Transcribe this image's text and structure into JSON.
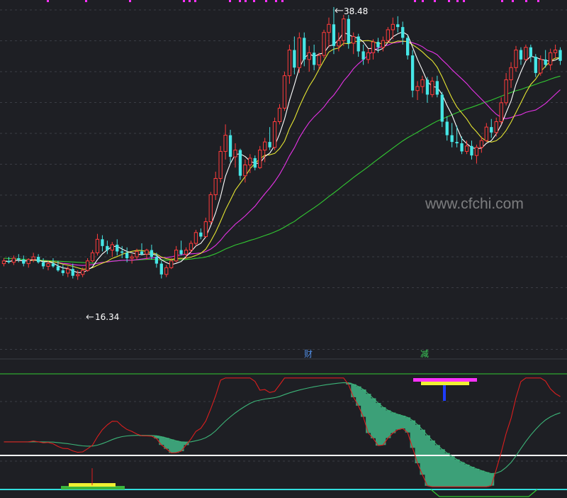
{
  "chart_data": {
    "type": "candlestick",
    "title": "",
    "annotations": {
      "high_label": "38.48",
      "low_label": "16.34",
      "marker_cai": "财",
      "marker_jian": "减",
      "watermark": "www.cfchi.com"
    },
    "price": {
      "ylim": [
        12.5,
        39.0
      ],
      "high": 38.48,
      "low": 16.34
    },
    "candles": [
      [
        19.5,
        19.9,
        19.3,
        19.7
      ],
      [
        19.7,
        20.0,
        19.5,
        19.6
      ],
      [
        19.6,
        20.1,
        19.4,
        19.9
      ],
      [
        19.9,
        20.2,
        19.6,
        19.8
      ],
      [
        19.8,
        20.1,
        19.3,
        19.5
      ],
      [
        19.5,
        19.9,
        19.2,
        19.8
      ],
      [
        19.8,
        20.3,
        19.6,
        20.0
      ],
      [
        20.0,
        20.2,
        19.5,
        19.6
      ],
      [
        19.6,
        19.9,
        19.1,
        19.3
      ],
      [
        19.3,
        19.7,
        19.0,
        19.5
      ],
      [
        19.5,
        19.9,
        19.2,
        19.3
      ],
      [
        19.3,
        19.7,
        18.9,
        19.0
      ],
      [
        19.0,
        19.4,
        18.6,
        18.8
      ],
      [
        18.8,
        19.3,
        18.5,
        19.1
      ],
      [
        19.1,
        19.5,
        18.4,
        18.6
      ],
      [
        18.6,
        19.0,
        18.3,
        18.7
      ],
      [
        18.7,
        19.2,
        18.5,
        19.0
      ],
      [
        19.0,
        19.9,
        18.9,
        19.7
      ],
      [
        19.7,
        20.5,
        19.6,
        20.3
      ],
      [
        20.3,
        21.7,
        20.1,
        21.3
      ],
      [
        21.3,
        21.6,
        20.4,
        20.8
      ],
      [
        20.8,
        21.2,
        20.2,
        20.5
      ],
      [
        20.5,
        21.1,
        20.0,
        20.9
      ],
      [
        20.9,
        21.3,
        20.1,
        20.4
      ],
      [
        20.4,
        20.8,
        19.9,
        20.3
      ],
      [
        20.3,
        20.7,
        19.6,
        19.9
      ],
      [
        19.9,
        20.2,
        19.5,
        20.0
      ],
      [
        20.0,
        20.6,
        19.8,
        20.4
      ],
      [
        20.4,
        21.0,
        20.1,
        20.2
      ],
      [
        20.2,
        20.6,
        19.8,
        20.5
      ],
      [
        20.5,
        20.9,
        19.8,
        20.0
      ],
      [
        20.0,
        20.3,
        19.2,
        19.5
      ],
      [
        19.5,
        19.7,
        18.4,
        18.7
      ],
      [
        18.7,
        19.4,
        18.5,
        19.2
      ],
      [
        19.2,
        19.9,
        19.1,
        19.7
      ],
      [
        19.7,
        20.8,
        19.6,
        20.5
      ],
      [
        20.5,
        21.2,
        20.1,
        20.2
      ],
      [
        20.2,
        20.7,
        19.9,
        20.5
      ],
      [
        20.5,
        21.2,
        20.3,
        21.0
      ],
      [
        21.0,
        22.0,
        20.8,
        21.8
      ],
      [
        21.8,
        22.1,
        21.3,
        21.5
      ],
      [
        21.5,
        22.9,
        21.4,
        22.6
      ],
      [
        22.6,
        24.8,
        22.4,
        24.6
      ],
      [
        24.6,
        26.3,
        24.2,
        25.8
      ],
      [
        25.8,
        28.2,
        25.5,
        27.8
      ],
      [
        27.8,
        29.8,
        27.2,
        29.0
      ],
      [
        29.0,
        29.4,
        27.0,
        27.4
      ],
      [
        27.4,
        28.4,
        26.6,
        27.9
      ],
      [
        27.9,
        28.0,
        25.7,
        26.0
      ],
      [
        26.0,
        27.2,
        25.5,
        26.8
      ],
      [
        26.8,
        27.6,
        26.2,
        27.3
      ],
      [
        27.3,
        27.5,
        26.4,
        26.6
      ],
      [
        26.6,
        28.2,
        26.5,
        27.9
      ],
      [
        27.9,
        28.8,
        27.0,
        28.5
      ],
      [
        28.5,
        29.6,
        27.9,
        28.1
      ],
      [
        28.1,
        30.3,
        27.9,
        30.0
      ],
      [
        30.0,
        31.3,
        29.8,
        31.0
      ],
      [
        31.0,
        33.7,
        30.8,
        33.4
      ],
      [
        33.4,
        35.7,
        32.8,
        35.3
      ],
      [
        35.3,
        36.3,
        33.5,
        34.0
      ],
      [
        34.0,
        36.6,
        33.6,
        36.2
      ],
      [
        36.2,
        36.6,
        34.1,
        34.6
      ],
      [
        34.6,
        35.6,
        33.7,
        35.1
      ],
      [
        35.1,
        35.7,
        33.8,
        34.2
      ],
      [
        34.2,
        35.1,
        33.9,
        34.9
      ],
      [
        34.9,
        36.8,
        34.7,
        36.6
      ],
      [
        36.6,
        37.7,
        35.5,
        37.2
      ],
      [
        37.2,
        38.48,
        35.0,
        35.6
      ],
      [
        35.6,
        36.6,
        35.2,
        36.0
      ],
      [
        36.0,
        37.9,
        35.6,
        37.6
      ],
      [
        37.6,
        37.9,
        35.4,
        35.8
      ],
      [
        35.8,
        36.6,
        35.0,
        36.3
      ],
      [
        36.3,
        36.5,
        34.8,
        35.2
      ],
      [
        35.2,
        35.7,
        34.2,
        34.6
      ],
      [
        34.6,
        35.4,
        34.3,
        35.1
      ],
      [
        35.1,
        36.1,
        34.6,
        35.9
      ],
      [
        35.9,
        36.2,
        35.1,
        35.5
      ],
      [
        35.5,
        36.3,
        35.2,
        36.0
      ],
      [
        36.0,
        37.0,
        35.8,
        36.8
      ],
      [
        36.8,
        37.7,
        36.1,
        37.2
      ],
      [
        37.2,
        37.8,
        36.6,
        37.0
      ],
      [
        37.0,
        37.4,
        35.7,
        36.2
      ],
      [
        36.2,
        36.4,
        34.6,
        34.9
      ],
      [
        34.9,
        35.3,
        31.8,
        32.3
      ],
      [
        32.3,
        33.0,
        31.6,
        32.6
      ],
      [
        32.6,
        33.4,
        32.1,
        33.1
      ],
      [
        33.1,
        33.3,
        31.4,
        32.0
      ],
      [
        32.0,
        33.3,
        31.8,
        33.0
      ],
      [
        33.0,
        33.4,
        31.8,
        32.0
      ],
      [
        32.0,
        32.2,
        29.6,
        30.0
      ],
      [
        30.0,
        30.4,
        28.6,
        29.0
      ],
      [
        29.0,
        29.9,
        28.1,
        28.5
      ],
      [
        28.5,
        29.7,
        28.1,
        28.4
      ],
      [
        28.4,
        28.9,
        27.6,
        27.8
      ],
      [
        27.8,
        28.6,
        27.6,
        28.2
      ],
      [
        28.2,
        28.6,
        27.2,
        27.5
      ],
      [
        27.5,
        28.3,
        26.9,
        28.1
      ],
      [
        28.1,
        28.9,
        27.7,
        28.6
      ],
      [
        28.6,
        29.9,
        28.5,
        29.6
      ],
      [
        29.6,
        30.2,
        28.8,
        29.2
      ],
      [
        29.2,
        30.3,
        28.9,
        30.0
      ],
      [
        30.0,
        31.8,
        29.8,
        31.4
      ],
      [
        31.4,
        33.6,
        31.2,
        33.1
      ],
      [
        33.1,
        34.4,
        32.5,
        34.0
      ],
      [
        34.0,
        35.6,
        33.7,
        35.3
      ],
      [
        35.3,
        35.5,
        34.2,
        34.6
      ],
      [
        34.6,
        35.7,
        34.5,
        35.5
      ],
      [
        35.5,
        35.7,
        34.4,
        34.8
      ],
      [
        34.8,
        35.0,
        33.3,
        33.6
      ],
      [
        33.6,
        34.9,
        33.4,
        34.6
      ],
      [
        34.6,
        35.3,
        34.0,
        34.2
      ],
      [
        34.2,
        35.4,
        33.8,
        35.1
      ],
      [
        35.1,
        35.7,
        34.7,
        35.3
      ],
      [
        35.3,
        35.5,
        34.2,
        34.5
      ]
    ],
    "indicator": {
      "type": "line",
      "ylim": [
        -50,
        120
      ],
      "zero_line": 0,
      "signal_markers": [
        "yellow-bar",
        "magenta-bar",
        "blue-arrow"
      ]
    },
    "colors": {
      "up": "#ff3c3c",
      "down": "#46e6e6",
      "ma5": "#ffffff",
      "ma10": "#e6e632",
      "ma20": "#e632e6",
      "ma60": "#32c832",
      "osc_fast": "#dc1e1e",
      "osc_slow": "#3cb478",
      "histogram": "#3ca078",
      "background": "#1e1f24"
    }
  }
}
